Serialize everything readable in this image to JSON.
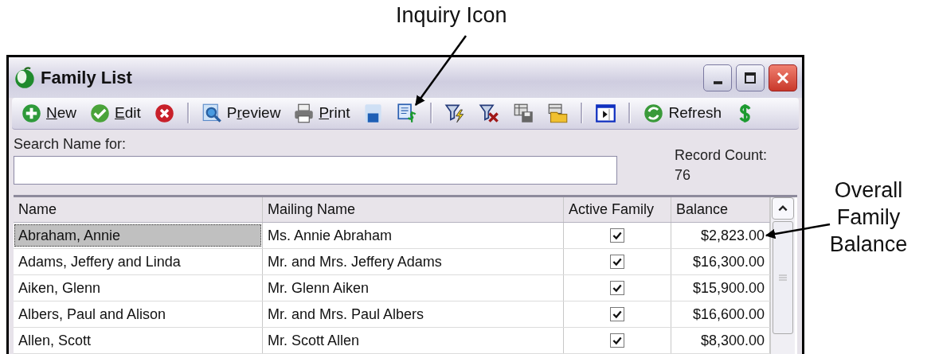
{
  "callouts": [
    {
      "text": "Inquiry Icon"
    },
    {
      "text": "Overall Family Balance"
    }
  ],
  "window": {
    "title": "Family List"
  },
  "toolbar": [
    {
      "kind": "button",
      "key": "N",
      "post": "ew"
    },
    {
      "kind": "button",
      "key": "E",
      "post": "dit"
    },
    {
      "kind": "icon"
    },
    {
      "kind": "separator"
    },
    {
      "kind": "button",
      "pre": "P",
      "key": "r",
      "post": "eview"
    },
    {
      "kind": "button",
      "key": "P",
      "post": "rint"
    },
    {
      "kind": "icon"
    },
    {
      "kind": "icon"
    },
    {
      "kind": "separator"
    },
    {
      "kind": "icon"
    },
    {
      "kind": "icon"
    },
    {
      "kind": "icon"
    },
    {
      "kind": "icon"
    },
    {
      "kind": "separator"
    },
    {
      "kind": "icon"
    },
    {
      "kind": "separator"
    },
    {
      "kind": "button",
      "pre": "Refresh"
    },
    {
      "kind": "icon"
    }
  ],
  "search": {
    "label": "Search Name for:"
  },
  "record_count": {
    "label": "Record Count:",
    "value": "76"
  },
  "table": {
    "columns": [
      "Name",
      "Mailing Name",
      "Active Family",
      "Balance"
    ],
    "rows": [
      {
        "name": "Abraham, Annie",
        "mailing_name": "Ms. Annie Abraham",
        "active": true,
        "balance": "$2,823.00",
        "selected": true
      },
      {
        "name": "Adams, Jeffery and Linda",
        "mailing_name": "Mr. and Mrs. Jeffery Adams",
        "active": true,
        "balance": "$16,300.00",
        "selected": false
      },
      {
        "name": "Aiken, Glenn",
        "mailing_name": "Mr. Glenn Aiken",
        "active": true,
        "balance": "$15,900.00",
        "selected": false
      },
      {
        "name": "Albers, Paul and Alison",
        "mailing_name": "Mr. and Mrs. Paul Albers",
        "active": true,
        "balance": "$16,600.00",
        "selected": false
      },
      {
        "name": "Allen, Scott",
        "mailing_name": "Mr. Scott Allen",
        "active": true,
        "balance": "$8,300.00",
        "selected": false
      }
    ]
  }
}
